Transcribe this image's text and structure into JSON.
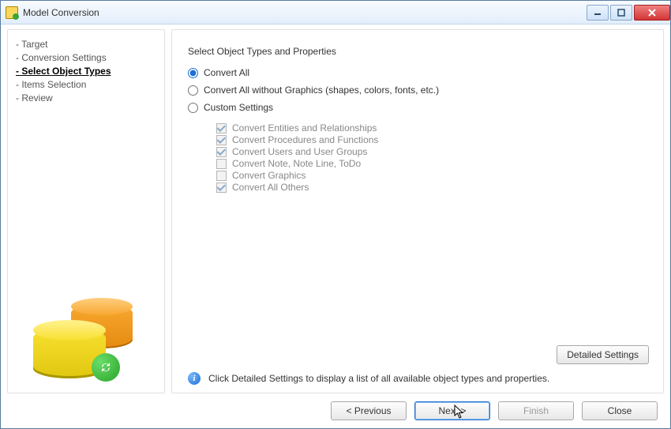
{
  "window": {
    "title": "Model Conversion"
  },
  "nav": {
    "steps": [
      {
        "label": "Target",
        "active": false
      },
      {
        "label": "Conversion Settings",
        "active": false
      },
      {
        "label": "Select Object Types",
        "active": true
      },
      {
        "label": "Items Selection",
        "active": false
      },
      {
        "label": "Review",
        "active": false
      }
    ]
  },
  "main": {
    "section_title": "Select Object Types and Properties",
    "radios": {
      "convert_all": "Convert All",
      "convert_no_graphics": "Convert All without Graphics (shapes, colors, fonts, etc.)",
      "custom": "Custom Settings"
    },
    "selected_radio": "convert_all",
    "custom_checks": [
      {
        "label": "Convert Entities and Relationships",
        "checked": true
      },
      {
        "label": "Convert Procedures and Functions",
        "checked": true
      },
      {
        "label": "Convert Users and User Groups",
        "checked": true
      },
      {
        "label": "Convert Note, Note Line, ToDo",
        "checked": false
      },
      {
        "label": "Convert Graphics",
        "checked": false
      },
      {
        "label": "Convert All Others",
        "checked": true
      }
    ],
    "detailed_button": "Detailed Settings",
    "info_text": "Click Detailed Settings to display a list of all available object types and properties."
  },
  "buttons": {
    "previous": "< Previous",
    "next": "Next >",
    "finish": "Finish",
    "close": "Close"
  }
}
